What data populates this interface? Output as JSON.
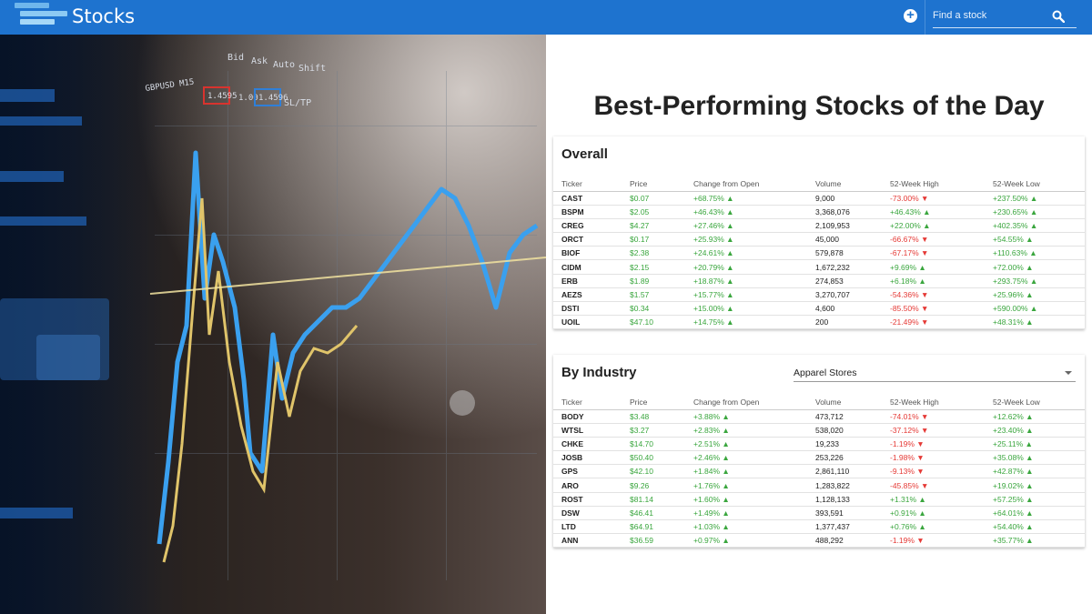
{
  "app": {
    "brand": "Stocks"
  },
  "search": {
    "placeholder": "Find a stock"
  },
  "page": {
    "title": "Best-Performing Stocks of the Day"
  },
  "colors": {
    "header": "#1e73cf",
    "positive": "#3aa63e",
    "negative": "#e53935"
  },
  "overall": {
    "title": "Overall",
    "columns": [
      "Ticker",
      "Price",
      "Change from Open",
      "Volume",
      "52-Week High",
      "52-Week Low"
    ],
    "rows": [
      [
        "CAST",
        "$0.07",
        "+68.75% ▲",
        "9,000",
        "-73.00% ▼",
        "+237.50% ▲"
      ],
      [
        "BSPM",
        "$2.05",
        "+46.43% ▲",
        "3,368,076",
        "+46.43% ▲",
        "+230.65% ▲"
      ],
      [
        "CREG",
        "$4.27",
        "+27.46% ▲",
        "2,109,953",
        "+22.00% ▲",
        "+402.35% ▲"
      ],
      [
        "ORCT",
        "$0.17",
        "+25.93% ▲",
        "45,000",
        "-66.67% ▼",
        "+54.55% ▲"
      ],
      [
        "BIOF",
        "$2.38",
        "+24.61% ▲",
        "579,878",
        "-67.17% ▼",
        "+110.63% ▲"
      ],
      [
        "CIDM",
        "$2.15",
        "+20.79% ▲",
        "1,672,232",
        "+9.69% ▲",
        "+72.00% ▲"
      ],
      [
        "ERB",
        "$1.89",
        "+18.87% ▲",
        "274,853",
        "+6.18% ▲",
        "+293.75% ▲"
      ],
      [
        "AEZS",
        "$1.57",
        "+15.77% ▲",
        "3,270,707",
        "-54.36% ▼",
        "+25.96% ▲"
      ],
      [
        "DSTI",
        "$0.34",
        "+15.00% ▲",
        "4,600",
        "-85.50% ▼",
        "+590.00% ▲"
      ],
      [
        "UOIL",
        "$47.10",
        "+14.75% ▲",
        "200",
        "-21.49% ▼",
        "+48.31% ▲"
      ]
    ]
  },
  "industry": {
    "title": "By Industry",
    "selected": "Apparel Stores",
    "columns": [
      "Ticker",
      "Price",
      "Change from Open",
      "Volume",
      "52-Week High",
      "52-Week Low"
    ],
    "rows": [
      [
        "BODY",
        "$3.48",
        "+3.88% ▲",
        "473,712",
        "-74.01% ▼",
        "+12.62% ▲"
      ],
      [
        "WTSL",
        "$3.27",
        "+2.83% ▲",
        "538,020",
        "-37.12% ▼",
        "+23.40% ▲"
      ],
      [
        "CHKE",
        "$14.70",
        "+2.51% ▲",
        "19,233",
        "-1.19% ▼",
        "+25.11% ▲"
      ],
      [
        "JOSB",
        "$50.40",
        "+2.46% ▲",
        "253,226",
        "-1.98% ▼",
        "+35.08% ▲"
      ],
      [
        "GPS",
        "$42.10",
        "+1.84% ▲",
        "2,861,110",
        "-9.13% ▼",
        "+42.87% ▲"
      ],
      [
        "ARO",
        "$9.26",
        "+1.76% ▲",
        "1,283,822",
        "-45.85% ▼",
        "+19.02% ▲"
      ],
      [
        "ROST",
        "$81.14",
        "+1.60% ▲",
        "1,128,133",
        "+1.31% ▲",
        "+57.25% ▲"
      ],
      [
        "DSW",
        "$46.41",
        "+1.49% ▲",
        "393,591",
        "+0.91% ▲",
        "+64.01% ▲"
      ],
      [
        "LTD",
        "$64.91",
        "+1.03% ▲",
        "1,377,437",
        "+0.76% ▲",
        "+54.40% ▲"
      ],
      [
        "ANN",
        "$36.59",
        "+0.97% ▲",
        "488,292",
        "-1.19% ▼",
        "+35.77% ▲"
      ]
    ]
  },
  "hero": {
    "labels": [
      "GBPUSD M15",
      "1.4595",
      "1.00",
      "1.4596",
      "Bid",
      "Ask",
      "Auto",
      "Shift",
      "SL/TP"
    ]
  }
}
